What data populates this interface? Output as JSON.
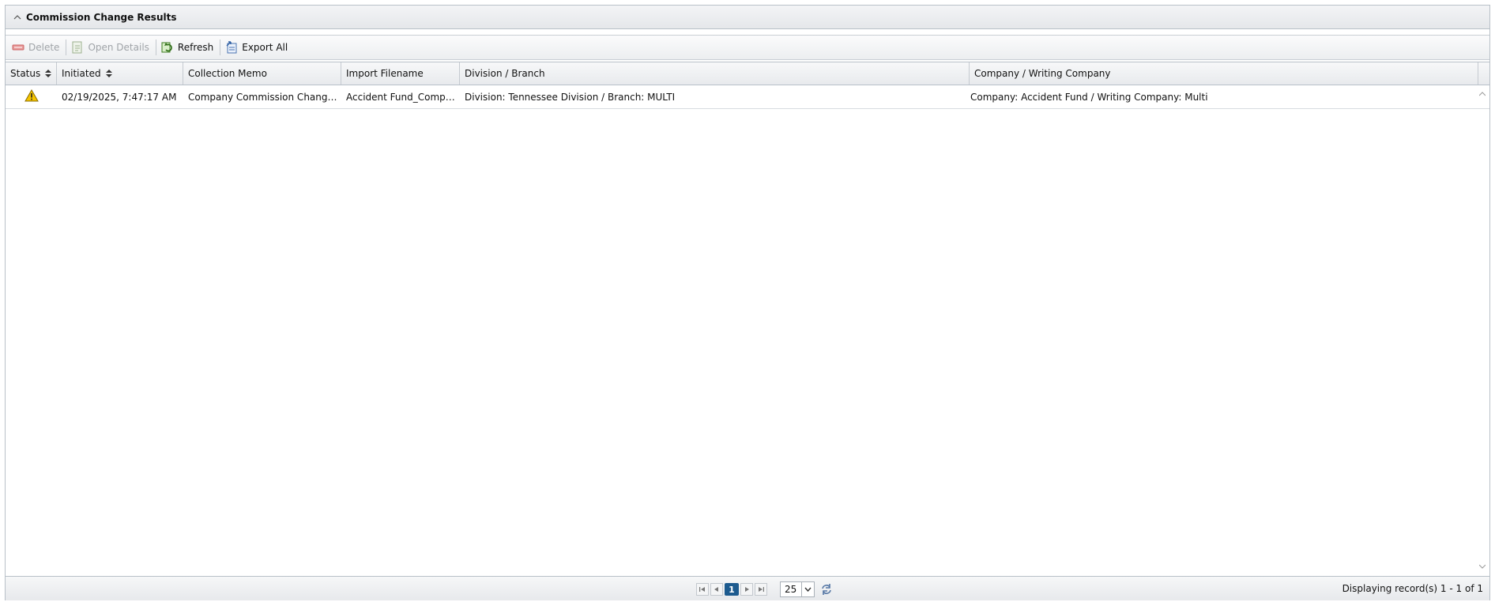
{
  "panel": {
    "title": "Commission Change Results"
  },
  "toolbar": {
    "delete_label": "Delete",
    "open_details_label": "Open Details",
    "refresh_label": "Refresh",
    "export_all_label": "Export All"
  },
  "grid": {
    "columns": [
      "Status",
      "Initiated",
      "Collection Memo",
      "Import Filename",
      "Division / Branch",
      "Company / Writing Company"
    ],
    "rows": [
      {
        "status_icon": "warning-icon",
        "initiated": "02/19/2025, 7:47:17 AM",
        "collection_memo": "Company Commission Change -...",
        "import_filename": "Accident Fund_Compa...",
        "division_branch": "Division: Tennessee Division / Branch: MULTI",
        "company_writing": "Company: Accident Fund / Writing Company: Multi"
      }
    ]
  },
  "pager": {
    "current_page": "1",
    "page_size": "25",
    "display_info": "Displaying record(s) 1 - 1 of 1"
  },
  "colors": {
    "header_bg": "#e5e7ea",
    "border": "#b8c0c8",
    "pager_active": "#1d5b8f",
    "warning": "#f5c400"
  }
}
